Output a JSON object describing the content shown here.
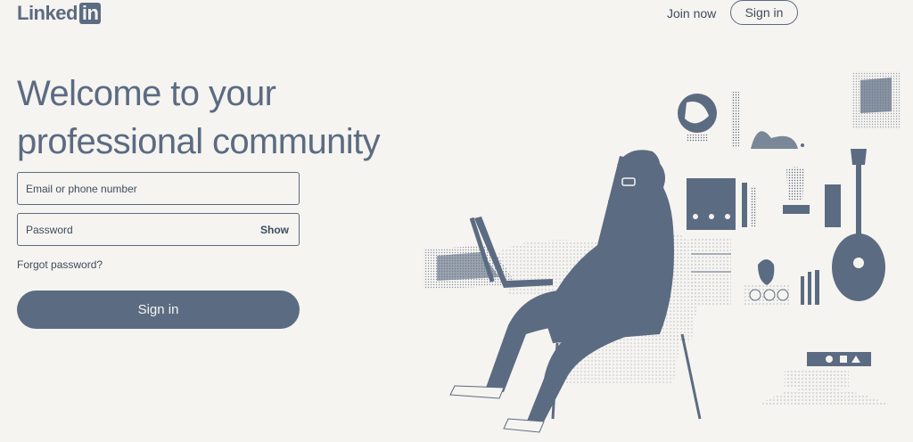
{
  "header": {
    "logo_text": "Linked",
    "logo_in": "in",
    "join_label": "Join now",
    "signin_label": "Sign in"
  },
  "main": {
    "headline": "Welcome to your professional community"
  },
  "form": {
    "email_placeholder": "Email or phone number",
    "password_placeholder": "Password",
    "show_label": "Show",
    "forgot_label": "Forgot password?",
    "submit_label": "Sign in"
  },
  "colors": {
    "background": "#f6f4f0",
    "accent": "#5b6b82",
    "text": "#3e4c5e"
  }
}
